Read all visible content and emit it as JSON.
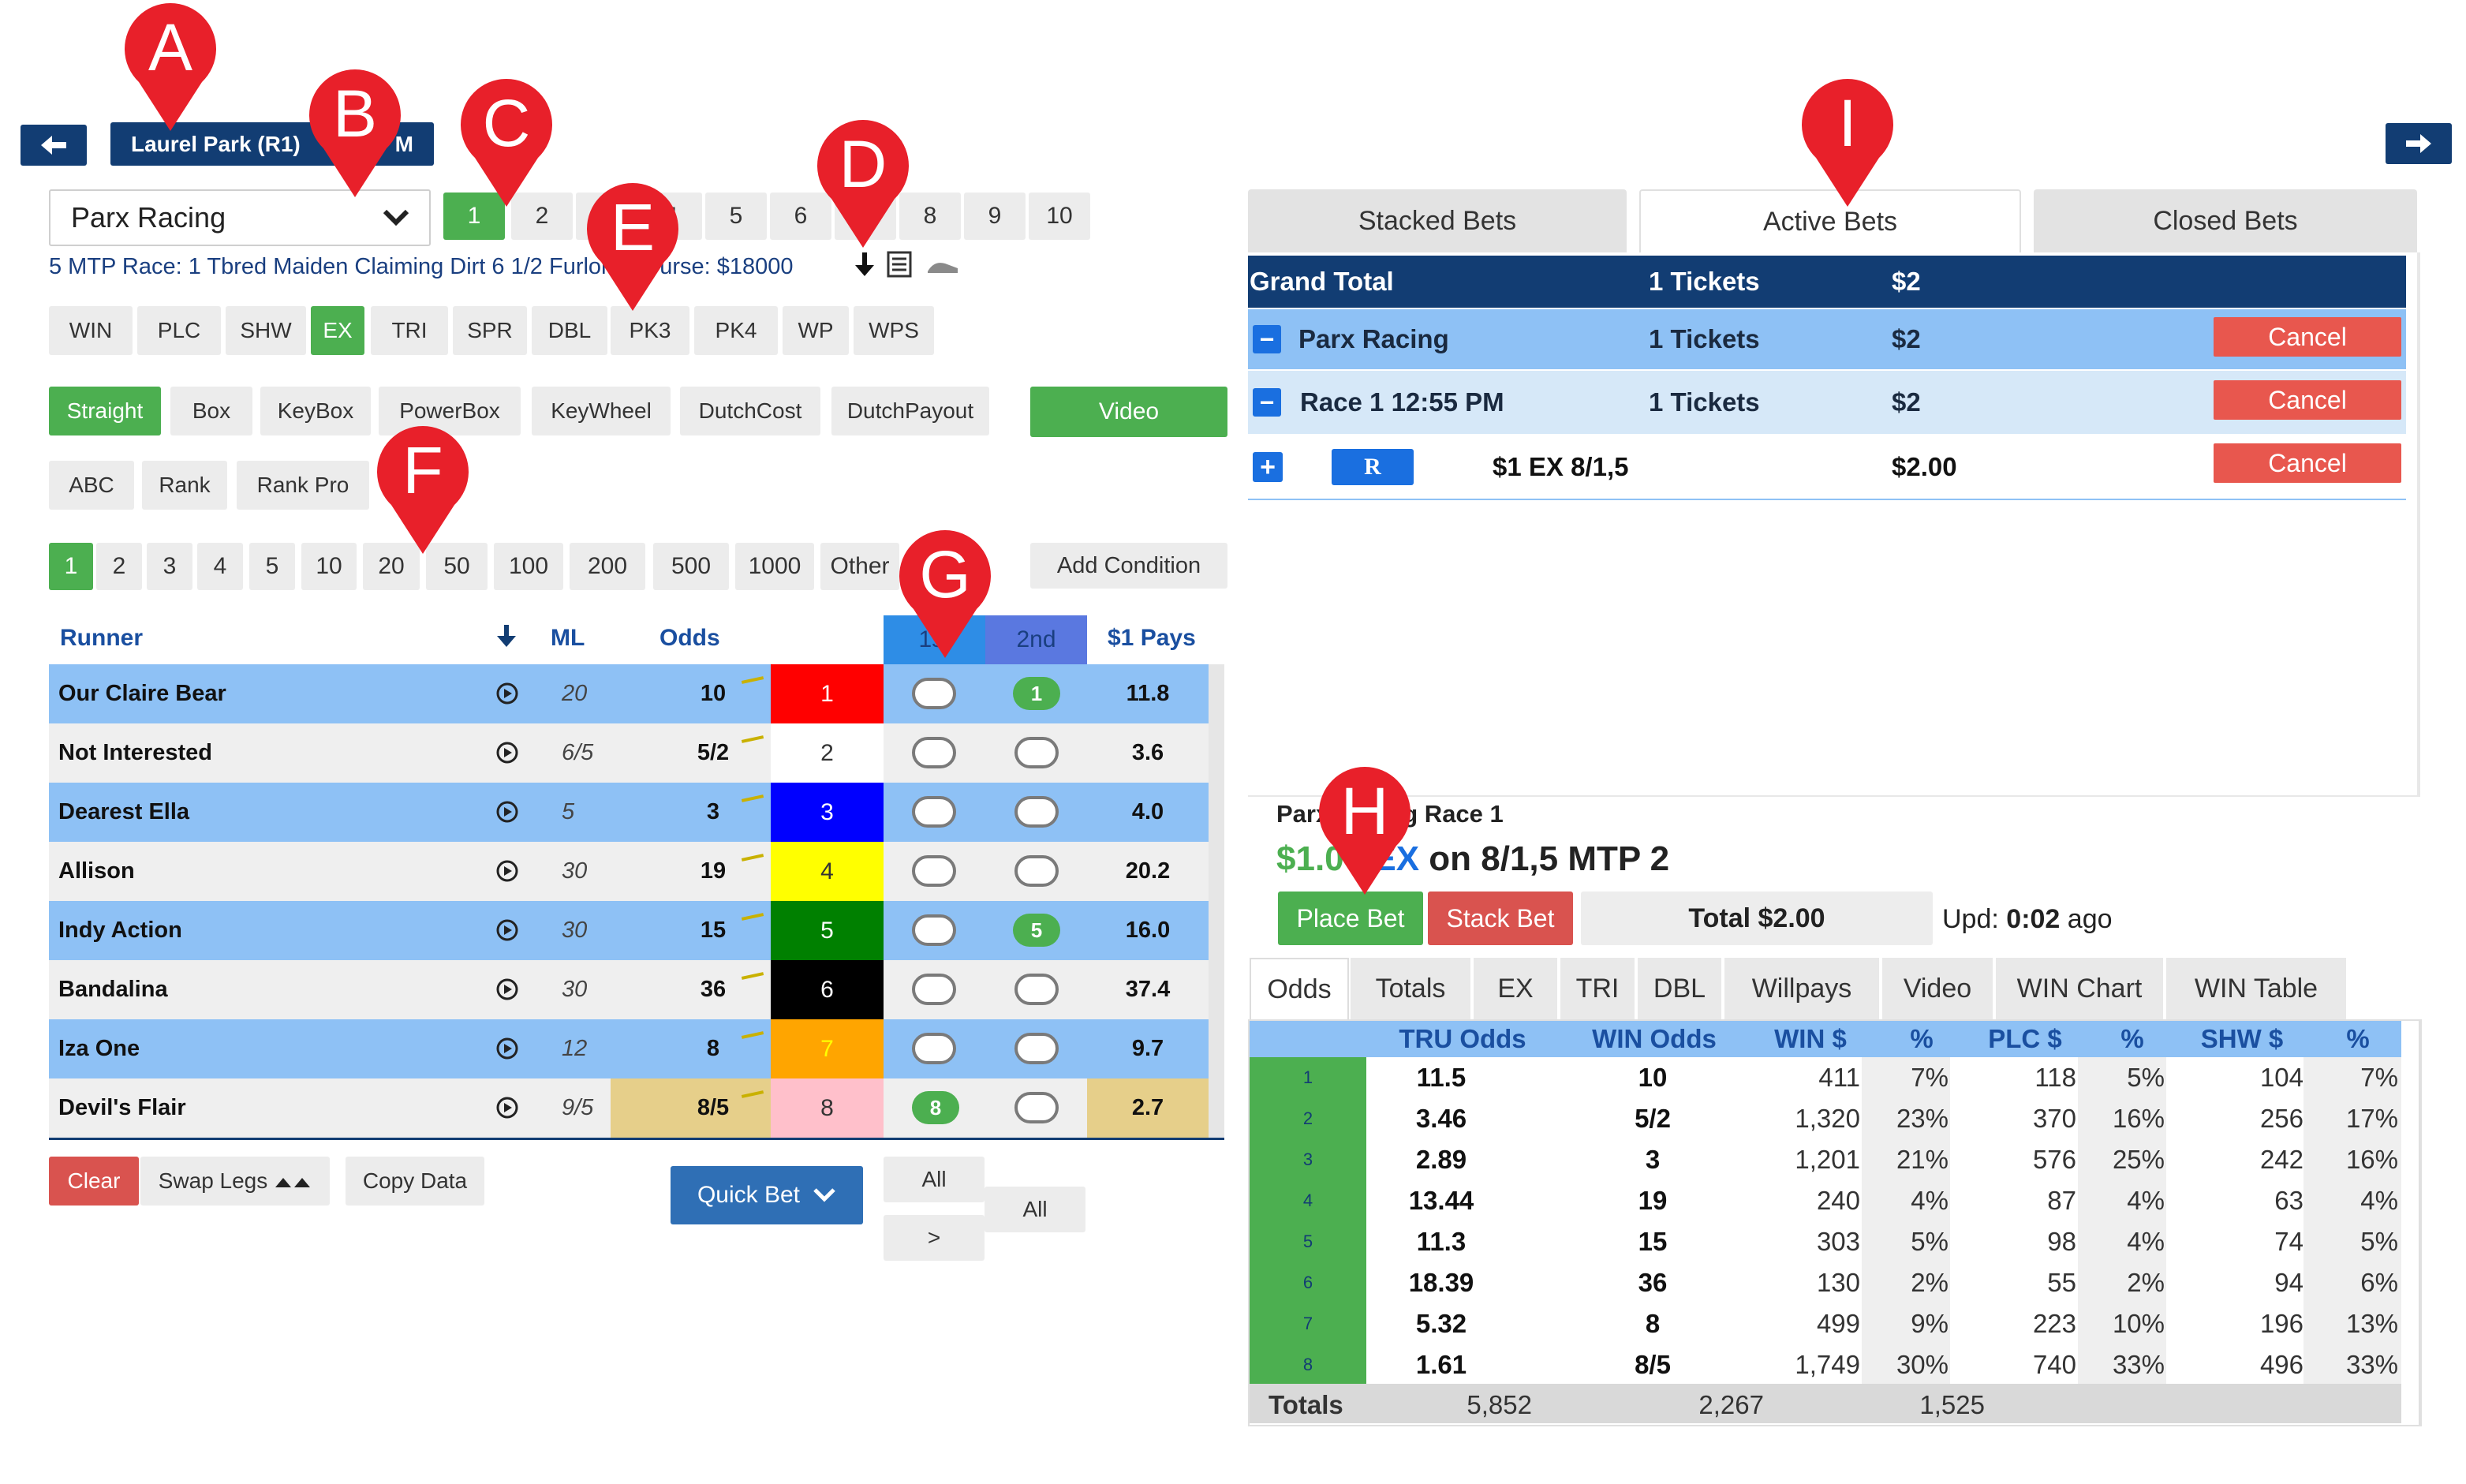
{
  "nav": {
    "back_icon": "arrow-left-icon",
    "forward_icon": "arrow-right-icon",
    "track_label": "Laurel Park (R1)",
    "track_suffix": "M"
  },
  "track_select": {
    "value": "Parx Racing"
  },
  "races": [
    "1",
    "2",
    "3",
    "4",
    "5",
    "6",
    "7",
    "8",
    "9",
    "10"
  ],
  "selected_race": "1",
  "race_info": {
    "text": "5 MTP Race: 1 Tbred Maiden Claiming Dirt 6 1/2 Furlongs Purse: $18000"
  },
  "bet_types": [
    "WIN",
    "PLC",
    "SHW",
    "EX",
    "TRI",
    "SPR",
    "DBL",
    "PK3",
    "PK4",
    "WP",
    "WPS"
  ],
  "selected_bet_type": "EX",
  "modifiers": [
    "Straight",
    "Box",
    "KeyBox",
    "PowerBox",
    "KeyWheel",
    "DutchCost",
    "DutchPayout"
  ],
  "modifiers_row2": [
    "ABC",
    "Rank",
    "Rank Pro"
  ],
  "video_label": "Video",
  "amounts": [
    "1",
    "2",
    "3",
    "4",
    "5",
    "10",
    "20",
    "50",
    "100",
    "200",
    "500",
    "1000",
    "Other"
  ],
  "add_condition_label": "Add Condition",
  "runner_table": {
    "headers": {
      "runner": "Runner",
      "ml": "ML",
      "odds": "Odds",
      "first": "1st",
      "second": "2nd",
      "pays": "$1 Pays"
    },
    "rows": [
      {
        "name": "Our Claire Bear",
        "ml": "20",
        "odds": "10",
        "num": "1",
        "pays": "11.8",
        "color": "#ff0000",
        "text": "#ffffff",
        "first": false,
        "second": true
      },
      {
        "name": "Not Interested",
        "ml": "6/5",
        "odds": "5/2",
        "num": "2",
        "pays": "3.6",
        "color": "#ffffff",
        "text": "#333333",
        "first": false,
        "second": false
      },
      {
        "name": "Dearest Ella",
        "ml": "5",
        "odds": "3",
        "num": "3",
        "pays": "4.0",
        "color": "#0000ff",
        "text": "#ffffff",
        "first": false,
        "second": false
      },
      {
        "name": "Allison",
        "ml": "30",
        "odds": "19",
        "num": "4",
        "pays": "20.2",
        "color": "#ffff00",
        "text": "#333333",
        "first": false,
        "second": false
      },
      {
        "name": "Indy Action",
        "ml": "30",
        "odds": "15",
        "num": "5",
        "pays": "16.0",
        "color": "#008000",
        "text": "#ffffff",
        "first": false,
        "second": true
      },
      {
        "name": "Bandalina",
        "ml": "30",
        "odds": "36",
        "num": "6",
        "pays": "37.4",
        "color": "#000000",
        "text": "#ffffff",
        "first": false,
        "second": false
      },
      {
        "name": "Iza One",
        "ml": "12",
        "odds": "8",
        "num": "7",
        "pays": "9.7",
        "color": "#ffa500",
        "text": "#ffff00",
        "first": false,
        "second": false
      },
      {
        "name": "Devil's Flair",
        "ml": "9/5",
        "odds": "8/5",
        "num": "8",
        "pays": "2.7",
        "color": "#ffc0cb",
        "text": "#333333",
        "first": true,
        "second": false
      }
    ]
  },
  "bottom_controls": {
    "clear": "Clear",
    "swap": "Swap Legs",
    "copy": "Copy Data",
    "quick_bet": "Quick Bet",
    "all1": "All",
    "all2": "All",
    "next": ">"
  },
  "bets_tabs": [
    "Stacked Bets",
    "Active Bets",
    "Closed Bets"
  ],
  "active_bets": {
    "grand_total": {
      "label": "Grand Total",
      "tickets": "1 Tickets",
      "amount": "$2"
    },
    "track": {
      "label": "Parx Racing",
      "tickets": "1 Tickets",
      "amount": "$2",
      "cancel": "Cancel"
    },
    "race": {
      "label": "Race  1 12:55 PM",
      "tickets": "1 Tickets",
      "amount": "$2",
      "cancel": "Cancel"
    },
    "ticket": {
      "badge": "R",
      "desc": "$1 EX 8/1,5",
      "amount": "$2.00",
      "cancel": "Cancel"
    }
  },
  "bet_slip": {
    "race_title": "Parx Racing Race 1",
    "summary_amount": "$1.00",
    "summary_type": "EX",
    "summary_rest": "on 8/1,5 MTP 2",
    "place_bet": "Place Bet",
    "stack_bet": "Stack Bet",
    "total": "Total $2.00",
    "upd_prefix": "Upd:",
    "upd_value": "0:02",
    "upd_suffix": "ago"
  },
  "odds_tabs": [
    "Odds",
    "Totals",
    "EX",
    "TRI",
    "DBL",
    "Willpays",
    "Video",
    "WIN Chart",
    "WIN Table"
  ],
  "odds_table": {
    "headers": [
      "TRU Odds",
      "WIN Odds",
      "WIN $",
      "%",
      "PLC $",
      "%",
      "SHW $",
      "%"
    ],
    "rows": [
      [
        "1",
        "11.5",
        "10",
        "411",
        "7%",
        "118",
        "5%",
        "104",
        "7%"
      ],
      [
        "2",
        "3.46",
        "5/2",
        "1,320",
        "23%",
        "370",
        "16%",
        "256",
        "17%"
      ],
      [
        "3",
        "2.89",
        "3",
        "1,201",
        "21%",
        "576",
        "25%",
        "242",
        "16%"
      ],
      [
        "4",
        "13.44",
        "19",
        "240",
        "4%",
        "87",
        "4%",
        "63",
        "4%"
      ],
      [
        "5",
        "11.3",
        "15",
        "303",
        "5%",
        "98",
        "4%",
        "74",
        "5%"
      ],
      [
        "6",
        "18.39",
        "36",
        "130",
        "2%",
        "55",
        "2%",
        "94",
        "6%"
      ],
      [
        "7",
        "5.32",
        "8",
        "499",
        "9%",
        "223",
        "10%",
        "196",
        "13%"
      ],
      [
        "8",
        "1.61",
        "8/5",
        "1,749",
        "30%",
        "740",
        "33%",
        "496",
        "33%"
      ]
    ],
    "totals": {
      "label": "Totals",
      "win": "5,852",
      "plc": "2,267",
      "shw": "1,525"
    }
  },
  "callouts": [
    "A",
    "B",
    "C",
    "D",
    "E",
    "F",
    "G",
    "H",
    "I"
  ],
  "colors": {
    "navy": "#123d73",
    "accent_blue": "#8ec1f5",
    "green": "#4caf50",
    "red": "#d9534f",
    "callout": "#e8202a"
  }
}
